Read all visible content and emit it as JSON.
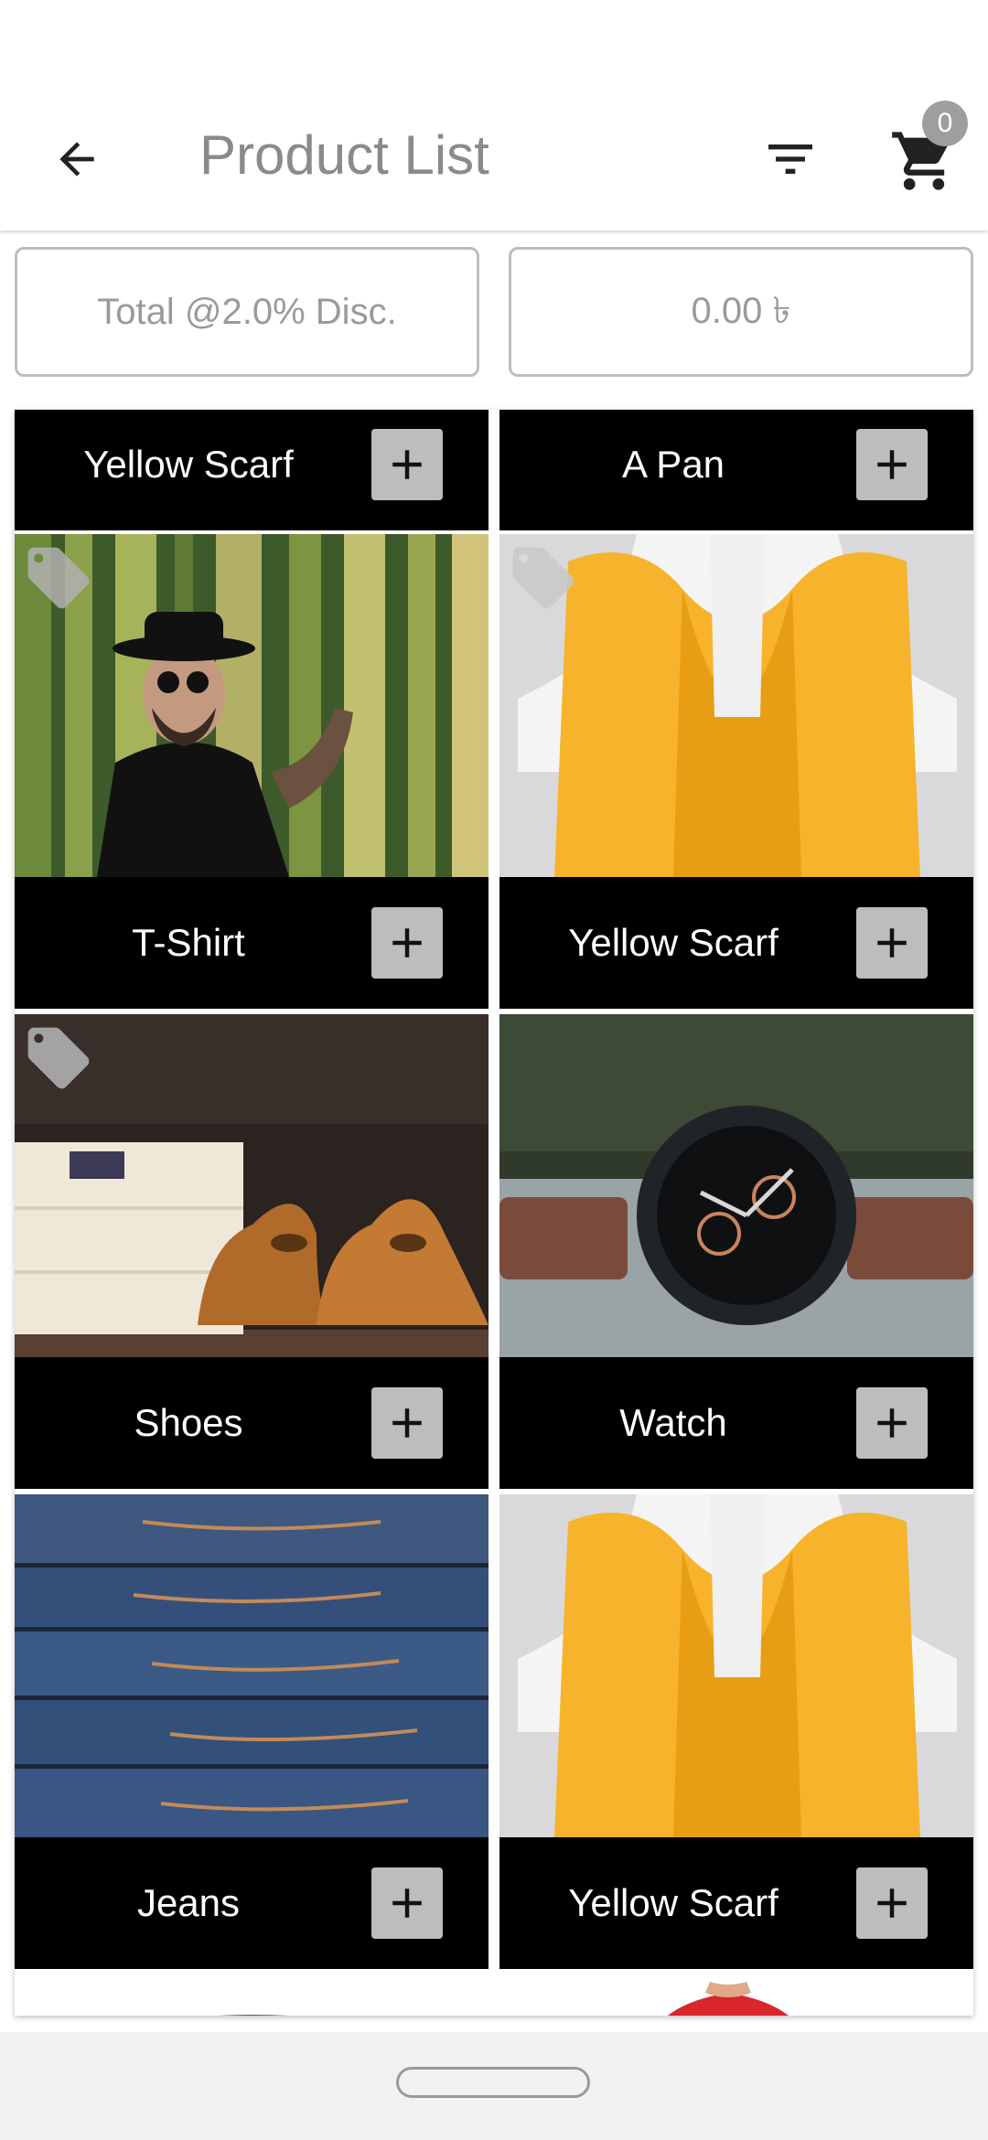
{
  "header": {
    "title": "Product List",
    "cart_count": "0"
  },
  "totals": {
    "label": "Total @2.0% Disc.",
    "value": "0.00 ৳"
  },
  "products": [
    {
      "name": "Yellow Scarf"
    },
    {
      "name": "A Pan"
    },
    {
      "name": "T-Shirt",
      "photo": "man-in-bamboo-forest"
    },
    {
      "name": "Yellow Scarf",
      "photo": "yellow-knit-scarf"
    },
    {
      "name": "Shoes",
      "photo": "brown-shoes-and-shirts"
    },
    {
      "name": "Watch",
      "photo": "wristwatch"
    },
    {
      "name": "Jeans",
      "photo": "stacked-jeans"
    },
    {
      "name": "Yellow Scarf",
      "photo": "yellow-knit-scarf"
    }
  ],
  "colors": {
    "card_bar": "#000000",
    "add_button": "#bdbdbd",
    "title_text": "#8a8a8a",
    "scarf": "#f7b32b"
  },
  "icons": {
    "back": "arrow-left-icon",
    "filter": "filter-icon",
    "cart": "cart-icon",
    "add": "plus-icon",
    "tag": "tag-icon"
  }
}
